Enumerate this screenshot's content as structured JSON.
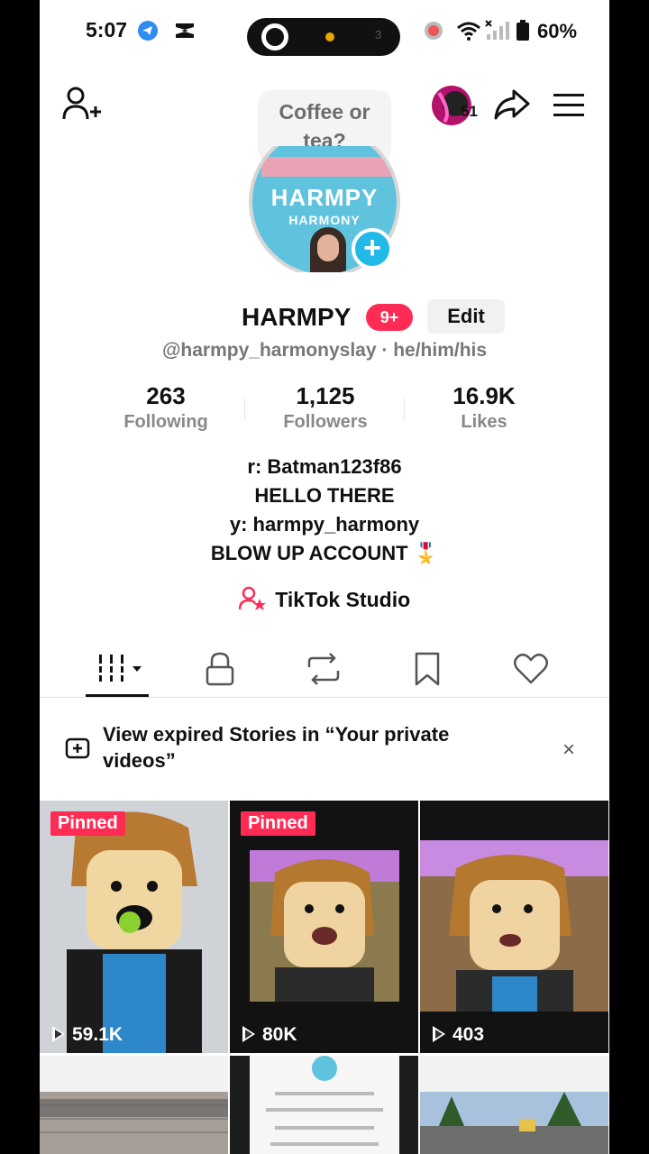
{
  "status_bar": {
    "time": "5:07",
    "battery": "60%",
    "pill_number": "3"
  },
  "header": {
    "bubble_text": "Coffee or tea?",
    "avatar_count": "51"
  },
  "profile": {
    "picture_title": "HARMPY",
    "picture_subtitle": "HARMONY",
    "name": "HARMPY",
    "notification_badge": "9+",
    "edit_label": "Edit",
    "handle": "@harmpy_harmonyslay · he/him/his"
  },
  "stats": [
    {
      "value": "263",
      "label": "Following"
    },
    {
      "value": "1,125",
      "label": "Followers"
    },
    {
      "value": "16.9K",
      "label": "Likes"
    }
  ],
  "bio": {
    "line1": "r: Batman123f86",
    "line2": "HELLO THERE",
    "line3": "y: harmpy_harmony",
    "line4": "BLOW UP ACCOUNT 🎖️"
  },
  "studio_label": "TikTok Studio",
  "notice": {
    "text": "View expired Stories in “Your private videos”",
    "close": "×"
  },
  "videos": [
    {
      "pinned": "Pinned",
      "views": "59.1K"
    },
    {
      "pinned": "Pinned",
      "views": "80K"
    },
    {
      "pinned": "",
      "views": "403"
    }
  ],
  "colors": {
    "accent": "#fe2c55",
    "blue": "#20b9e8"
  }
}
